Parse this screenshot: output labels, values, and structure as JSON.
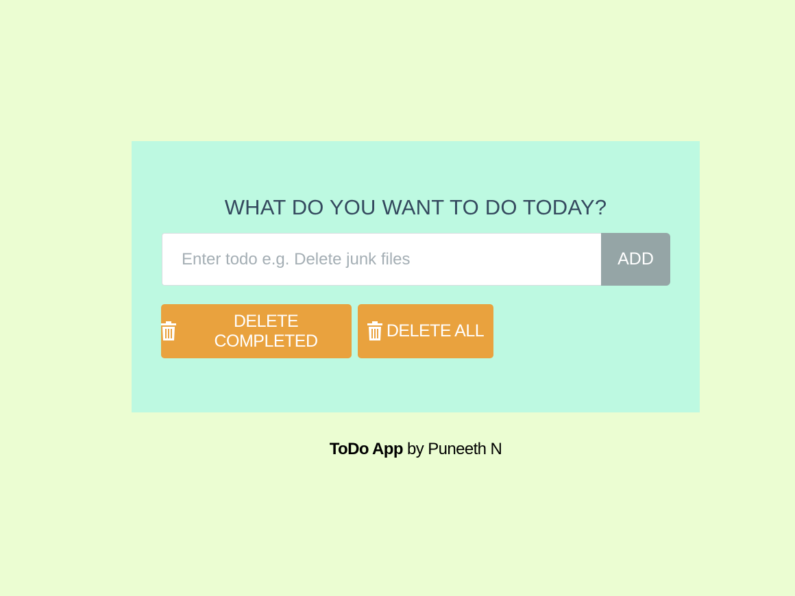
{
  "app": {
    "heading": "WHAT DO YOU WANT TO DO TODAY?"
  },
  "todo_form": {
    "input_placeholder": "Enter todo e.g. Delete junk files",
    "input_value": "",
    "add_label": "ADD"
  },
  "actions": {
    "delete_completed_label": "DELETE COMPLETED",
    "delete_all_label": "DELETE ALL",
    "icon": "trash-icon"
  },
  "footer": {
    "brand": "ToDo App",
    "byline": " by Puneeth N"
  },
  "colors": {
    "page_background": "#ebfdd2",
    "card_background": "#bdf9e1",
    "heading_text": "#34495e",
    "add_button": "#95a5a6",
    "action_button": "#e9a23e"
  }
}
